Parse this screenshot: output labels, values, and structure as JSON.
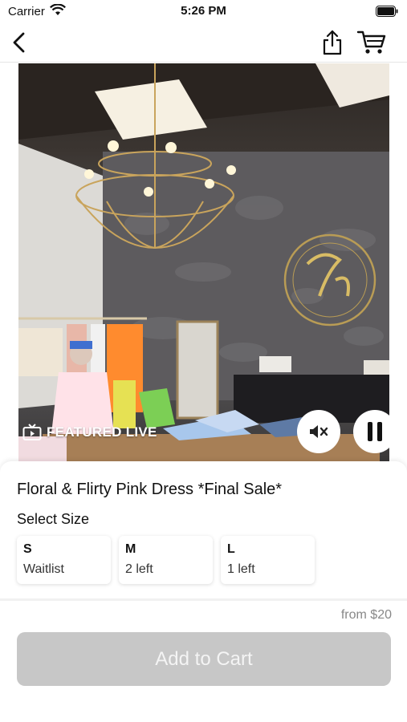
{
  "status_bar": {
    "carrier": "Carrier",
    "time": "5:26 PM"
  },
  "nav": {
    "icons": [
      "back-chevron-icon",
      "share-icon",
      "cart-icon"
    ]
  },
  "video": {
    "badge_label": "FEATURED LIVE",
    "badge_icon": "tv-icon",
    "controls": [
      "mute-icon",
      "pause-icon"
    ]
  },
  "product": {
    "title": "Floral & Flirty Pink Dress *Final Sale*",
    "select_size_label": "Select Size",
    "sizes": [
      {
        "name": "S",
        "stock": "Waitlist"
      },
      {
        "name": "M",
        "stock": "2 left"
      },
      {
        "name": "L",
        "stock": "1 left"
      }
    ],
    "price": "from $20",
    "add_to_cart_label": "Add to Cart"
  },
  "colors": {
    "button_disabled": "#c7c7c7",
    "price_text": "#888888"
  }
}
